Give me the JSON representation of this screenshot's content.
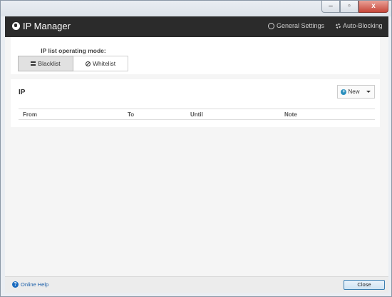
{
  "window": {
    "minimize": "–",
    "maximize": "▫",
    "close": "x"
  },
  "header": {
    "title": "IP Manager",
    "general_settings": "General Settings",
    "auto_blocking": "Auto-Blocking"
  },
  "mode": {
    "label": "IP list operating mode:",
    "blacklist": "Blacklist",
    "whitelist": "Whitelist",
    "selected": "Blacklist"
  },
  "ip_panel": {
    "title": "IP",
    "new_button": "New",
    "columns": [
      "From",
      "To",
      "Until",
      "Note"
    ]
  },
  "footer": {
    "online_help": "Online Help",
    "close": "Close"
  },
  "colors": {
    "header_bg": "#2b2b2b",
    "accent": "#2a8fbd",
    "link": "#1a5ea8"
  }
}
